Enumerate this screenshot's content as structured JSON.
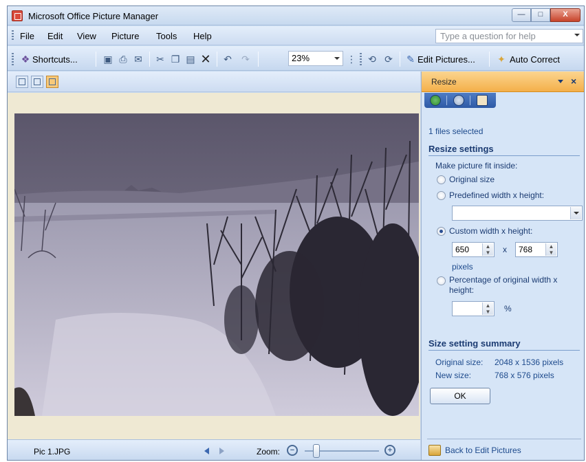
{
  "window": {
    "title": "Microsoft Office Picture Manager",
    "controls": {
      "minimize": "—",
      "maximize": "□",
      "close": "X"
    }
  },
  "menu": {
    "items": [
      {
        "label": "File"
      },
      {
        "label": "Edit"
      },
      {
        "label": "View"
      },
      {
        "label": "Picture"
      },
      {
        "label": "Tools"
      },
      {
        "label": "Help"
      }
    ],
    "help_placeholder": "Type a question for help"
  },
  "toolbar": {
    "shortcuts_label": "Shortcuts...",
    "zoom_value": "23%",
    "edit_pictures_label": "Edit Pictures...",
    "auto_correct_label": "Auto Correct"
  },
  "status": {
    "filename": "Pic 1.JPG",
    "zoom_label": "Zoom:"
  },
  "taskpane": {
    "title": "Resize",
    "files_selected": "1 files selected",
    "resize_settings_heading": "Resize settings",
    "fit_inside_label": "Make picture fit inside:",
    "options": {
      "original": "Original size",
      "predefined": "Predefined width x height:",
      "custom": "Custom width x height:",
      "percentage_line1": "Percentage of original width x",
      "percentage_line2": "height:"
    },
    "selected_option": "custom",
    "predefined_value": "",
    "custom_width": "650",
    "custom_height": "768",
    "times_symbol": "x",
    "pixels_label": "pixels",
    "percentage_value": "",
    "percent_symbol": "%",
    "summary_heading": "Size setting summary",
    "summary": {
      "original_label": "Original size:",
      "original_value": "2048 x 1536 pixels",
      "new_label": "New size:",
      "new_value": "768 x 576 pixels"
    },
    "ok_label": "OK",
    "back_link": "Back to Edit Pictures"
  },
  "colors": {
    "accent_orange": "#f4b04a",
    "pane_background": "#d6e5f7",
    "link_blue": "#1d4a8c"
  }
}
